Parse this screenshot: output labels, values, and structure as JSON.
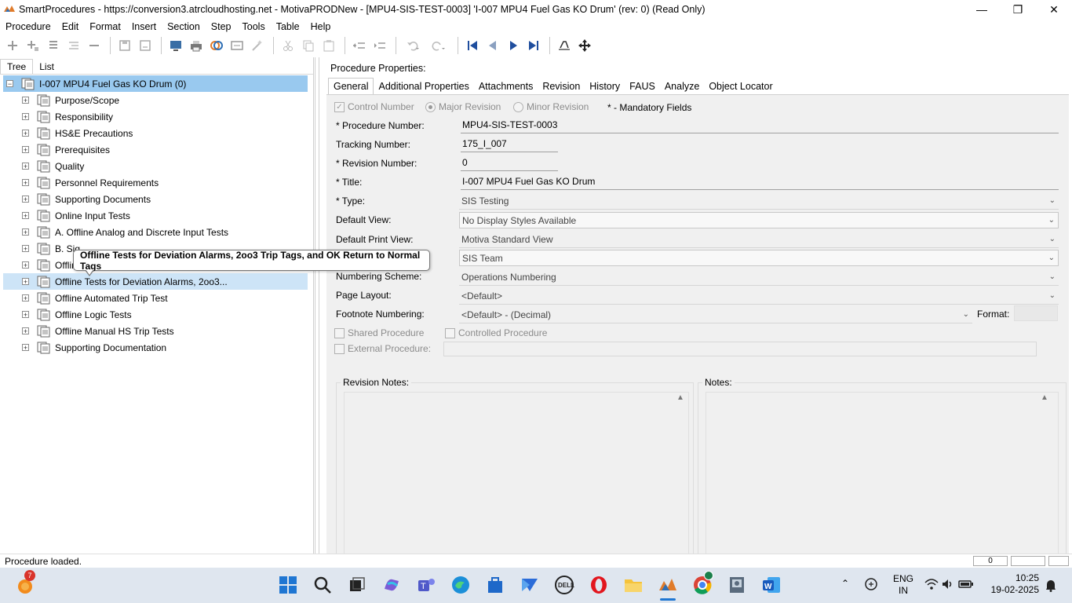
{
  "window": {
    "title": "SmartProcedures - https://conversion3.atrcloudhosting.net - MotivaPRODNew - [MPU4-SIS-TEST-0003] 'I-007 MPU4 Fuel Gas KO Drum' (rev: 0) (Read Only)"
  },
  "menu": [
    "Procedure",
    "Edit",
    "Format",
    "Insert",
    "Section",
    "Step",
    "Tools",
    "Table",
    "Help"
  ],
  "left_tabs": [
    "Tree",
    "List"
  ],
  "tree": {
    "root": "I-007 MPU4 Fuel Gas KO Drum (0)",
    "items": [
      "Purpose/Scope",
      "Responsibility",
      "HS&E Precautions",
      "Prerequisites",
      "Quality",
      "Personnel Requirements",
      "Supporting Documents",
      "Online Input Tests",
      "A. Offline Analog and Discrete Input Tests",
      "B. Sig",
      "Offlin",
      "Offline Tests for Deviation Alarms, 2oo3...",
      "Offline Automated Trip Test",
      "Offline Logic Tests",
      "Offline Manual HS Trip Tests",
      "Supporting Documentation"
    ],
    "tooltip": "Offline Tests for Deviation Alarms, 2oo3 Trip Tags, and OK Return to Normal Tags"
  },
  "right": {
    "title": "Procedure Properties:",
    "tabs": [
      "General",
      "Additional Properties",
      "Attachments",
      "Revision",
      "History",
      "FAUS",
      "Analyze",
      "Object Locator"
    ],
    "control_number": "Control Number",
    "major_revision": "Major Revision",
    "minor_revision": "Minor Revision",
    "mandatory": "* - Mandatory Fields",
    "fields": {
      "procedure_number_label": "* Procedure Number:",
      "procedure_number": "MPU4-SIS-TEST-0003",
      "tracking_number_label": "Tracking Number:",
      "tracking_number": "175_I_007",
      "revision_number_label": "* Revision Number:",
      "revision_number": "0",
      "title_label": "* Title:",
      "title": "I-007 MPU4 Fuel Gas KO Drum",
      "type_label": "* Type:",
      "type": "SIS Testing",
      "default_view_label": "Default View:",
      "default_view": "No Display Styles Available",
      "default_print_view_label": "Default Print View:",
      "default_print_view": "Motiva Standard View",
      "owner": "SIS Team",
      "numbering_scheme_label": "Numbering Scheme:",
      "numbering_scheme": "Operations Numbering",
      "page_layout_label": "Page Layout:",
      "page_layout": "<Default>",
      "footnote_numbering_label": "Footnote Numbering:",
      "footnote_numbering": "<Default> - (Decimal)",
      "format_label": "Format:",
      "shared_procedure": "Shared Procedure",
      "controlled_procedure": "Controlled Procedure",
      "external_procedure": "External Procedure:"
    },
    "revision_notes_label": "Revision Notes:",
    "notes_label": "Notes:"
  },
  "status": {
    "text": "Procedure loaded.",
    "panel_value": "0"
  },
  "taskbar": {
    "badge": "7",
    "language": "ENG",
    "region": "IN",
    "time": "10:25",
    "date": "19-02-2025"
  }
}
